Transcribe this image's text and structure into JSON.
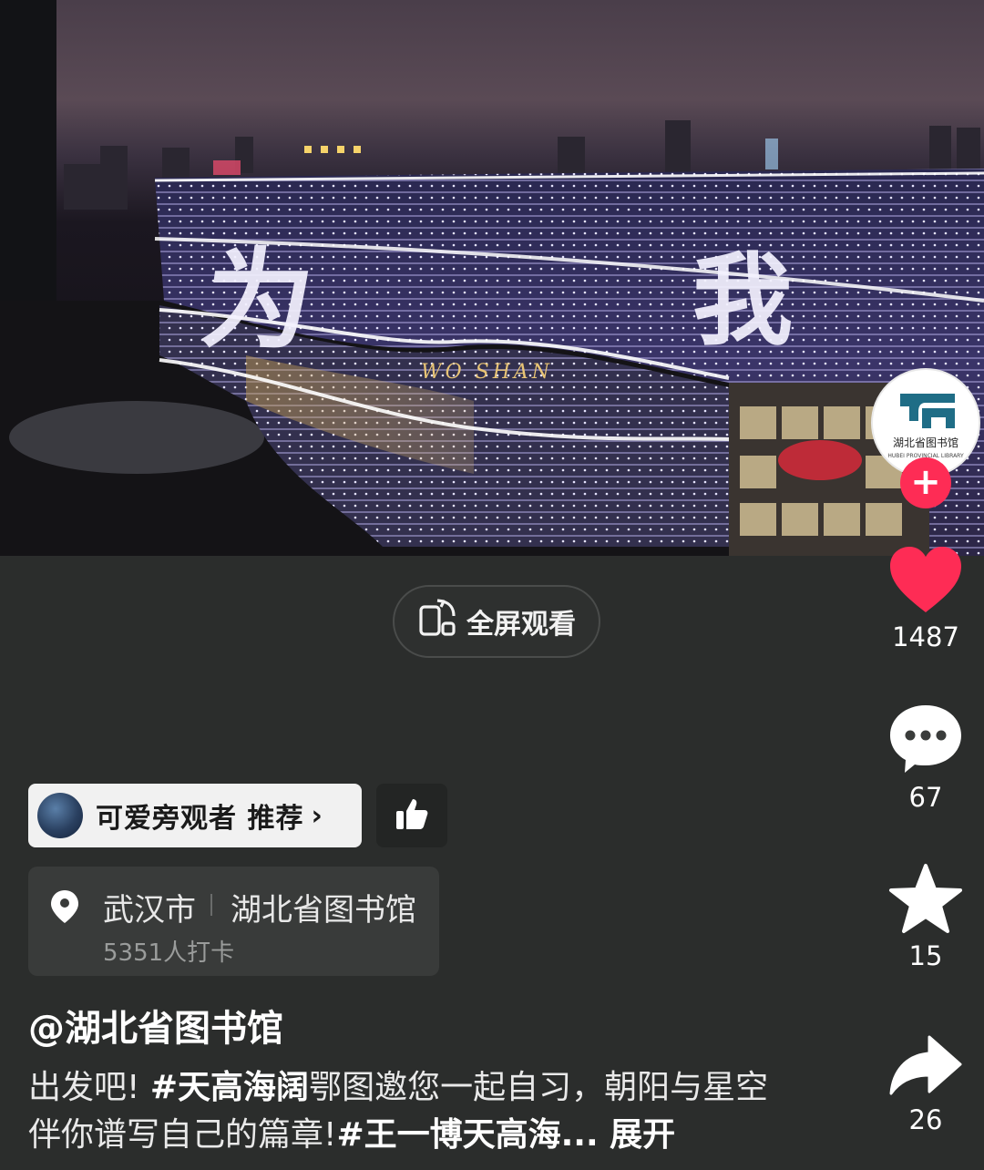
{
  "video": {
    "overlay_chars": [
      "为",
      "我"
    ],
    "facade_text": "WO SHAN"
  },
  "fullscreen": {
    "label": "全屏观看",
    "icon": "rotate-phone-icon"
  },
  "author_avatar": {
    "logo_text": "湖北省图书馆",
    "logo_subtext": "HUBEI PROVINCIAL LIBRARY"
  },
  "actions": {
    "like": {
      "icon": "heart-icon",
      "count": "1487",
      "color": "#fe2c55"
    },
    "comment": {
      "icon": "comment-icon",
      "count": "67"
    },
    "favorite": {
      "icon": "star-icon",
      "count": "15"
    },
    "share": {
      "icon": "share-arrow-icon",
      "count": "26"
    }
  },
  "recommend": {
    "text": "可爱旁观者 推荐",
    "chevron": "›",
    "thumb_icon": "thumbs-up-icon"
  },
  "location": {
    "city": "武汉市",
    "place": "湖北省图书馆",
    "checkins": "5351人打卡",
    "icon": "location-pin-icon"
  },
  "caption": {
    "author": "@湖北省图书馆",
    "part1": "出发吧! ",
    "hashtag1": "#天高海阔",
    "part2": "鄂图邀您一起自习，朝阳与星空伴你谱写自己的篇章!",
    "hashtag2": "#王一博天高海...",
    "expand": " 展开"
  }
}
